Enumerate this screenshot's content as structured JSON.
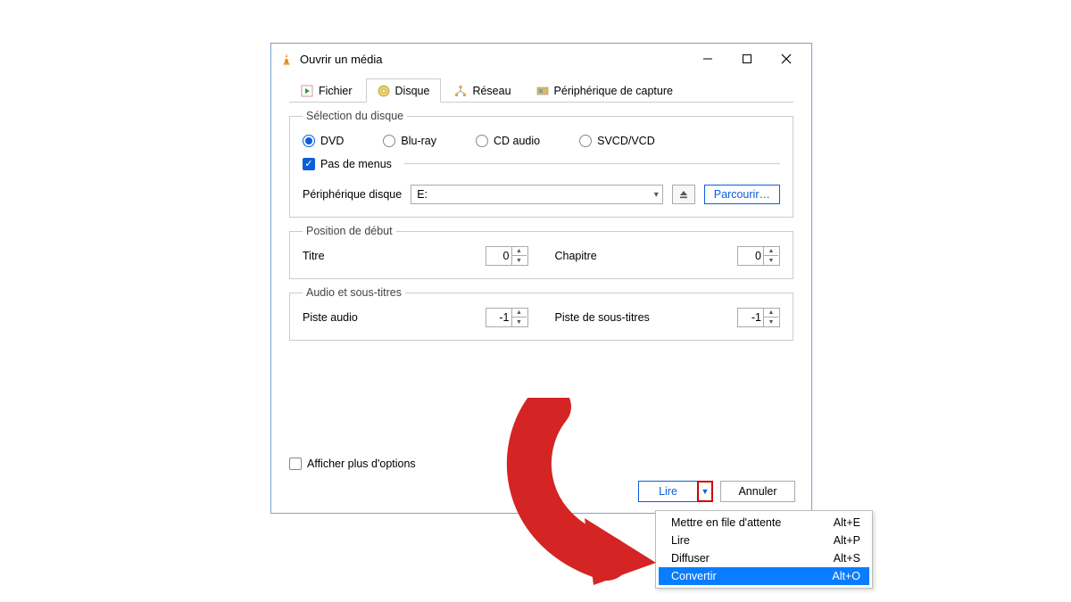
{
  "window": {
    "title": "Ouvrir un média"
  },
  "tabs": {
    "file": "Fichier",
    "disc": "Disque",
    "network": "Réseau",
    "capture": "Périphérique de capture"
  },
  "disc_selection": {
    "legend": "Sélection du disque",
    "options": {
      "dvd": "DVD",
      "bluray": "Blu-ray",
      "cdaudio": "CD audio",
      "svcd": "SVCD/VCD"
    },
    "no_menus": "Pas de menus",
    "device_label": "Périphérique disque",
    "device_value": "E:",
    "browse": "Parcourir…"
  },
  "start_position": {
    "legend": "Position de début",
    "title_label": "Titre",
    "title_value": "0",
    "chapter_label": "Chapitre",
    "chapter_value": "0"
  },
  "audio_sub": {
    "legend": "Audio et sous-titres",
    "audio_label": "Piste audio",
    "audio_value": "-1",
    "subs_label": "Piste de sous-titres",
    "subs_value": "-1"
  },
  "more_options": "Afficher plus d'options",
  "actions": {
    "play": "Lire",
    "cancel": "Annuler"
  },
  "dropdown": {
    "items": [
      {
        "label": "Mettre en file d'attente",
        "shortcut": "Alt+E"
      },
      {
        "label": "Lire",
        "shortcut": "Alt+P"
      },
      {
        "label": "Diffuser",
        "shortcut": "Alt+S"
      },
      {
        "label": "Convertir",
        "shortcut": "Alt+O",
        "selected": true
      }
    ]
  }
}
